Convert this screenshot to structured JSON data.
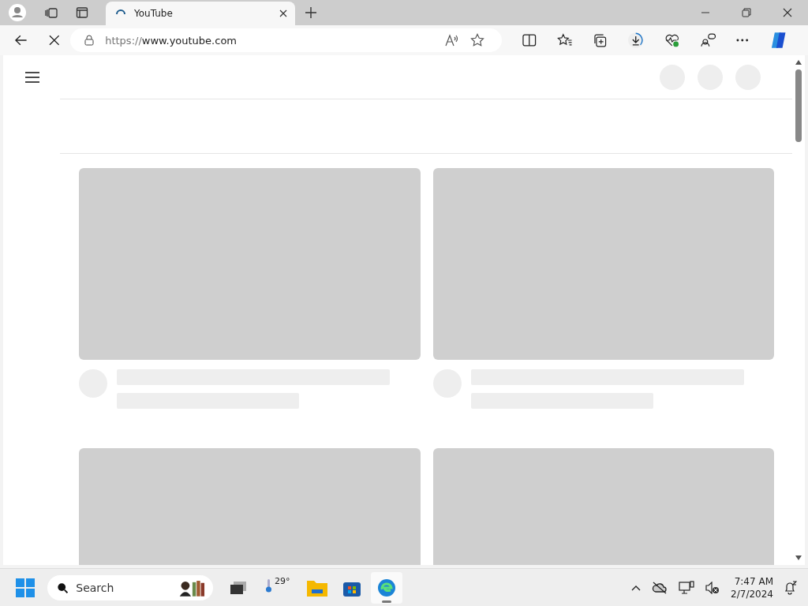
{
  "browser": {
    "tab": {
      "title": "YouTube",
      "loading": true
    },
    "url": {
      "scheme": "https://",
      "host": "www.youtube.com"
    }
  },
  "page": {
    "cards": [
      {
        "kind": "skeleton"
      },
      {
        "kind": "skeleton"
      },
      {
        "kind": "thumbnail-only"
      },
      {
        "kind": "thumbnail-only"
      }
    ]
  },
  "taskbar": {
    "search": {
      "placeholder": "Search"
    },
    "weather": {
      "temperature": "29°"
    },
    "apps": [
      {
        "kind": "task-view",
        "selected": false
      },
      {
        "kind": "files",
        "selected": false
      },
      {
        "kind": "store",
        "selected": false
      },
      {
        "kind": "edge",
        "selected": true
      }
    ],
    "clock": {
      "time": "7:47 AM",
      "date": "2/7/2024"
    }
  }
}
